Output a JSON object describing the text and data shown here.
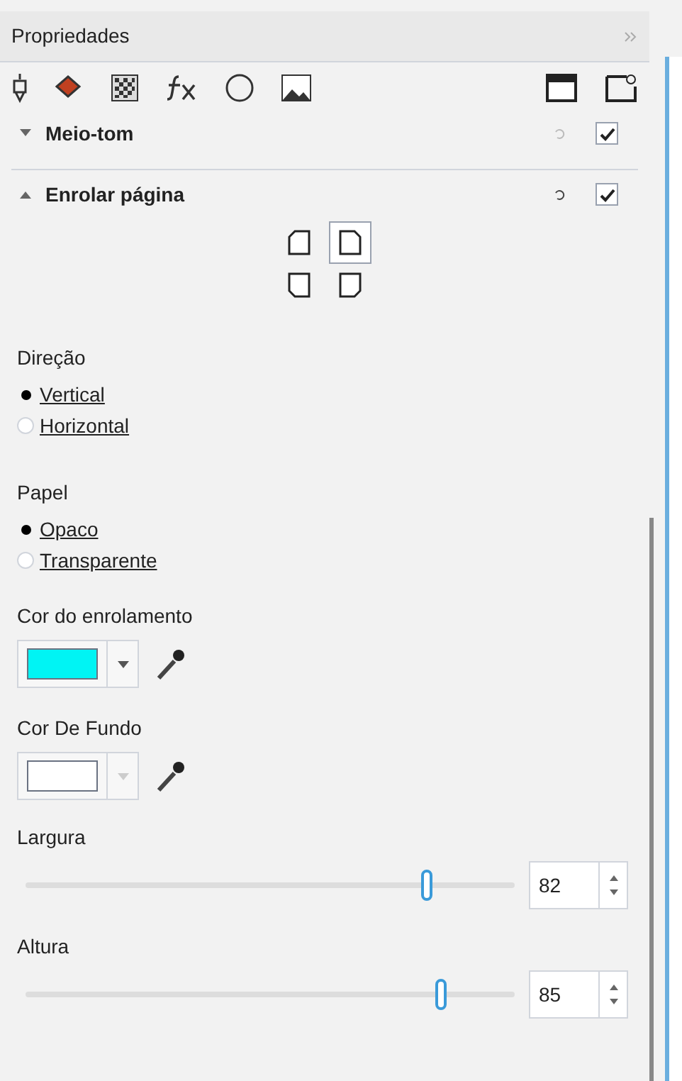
{
  "panel": {
    "title": "Propriedades"
  },
  "sections": [
    {
      "title": "Meio-tom",
      "expanded": false,
      "enabled": true
    },
    {
      "title": "Enrolar página",
      "expanded": true,
      "enabled": true
    }
  ],
  "curl_corners": [
    {
      "selected": false
    },
    {
      "selected": true
    },
    {
      "selected": false
    },
    {
      "selected": false
    }
  ],
  "radio_groups": [
    {
      "label": "Direção",
      "options": [
        {
          "label": "Vertical",
          "selected": true
        },
        {
          "label": "Horizontal",
          "selected": false
        }
      ]
    },
    {
      "label": "Papel",
      "options": [
        {
          "label": "Opaco",
          "selected": true
        },
        {
          "label": "Transparente",
          "selected": false
        }
      ]
    }
  ],
  "color_pickers": [
    {
      "label": "Cor do enrolamento",
      "color": "#00f4f4",
      "disabled": false
    },
    {
      "label": "Cor De Fundo",
      "color": "#ffffff",
      "disabled": true
    }
  ],
  "sliders": [
    {
      "label": "Largura",
      "level": 0.82,
      "value": "82"
    },
    {
      "label": "Altura",
      "level": 0.85,
      "value": "85"
    }
  ]
}
